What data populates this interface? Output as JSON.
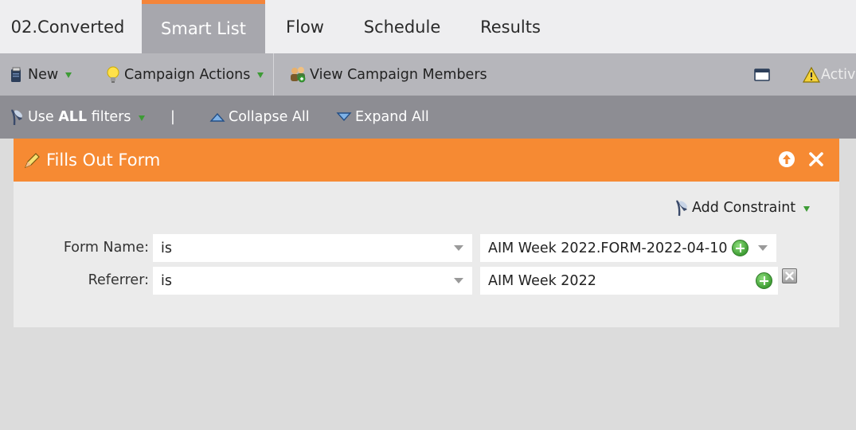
{
  "tabs": [
    {
      "label": "02.Converted"
    },
    {
      "label": "Smart List"
    },
    {
      "label": "Flow"
    },
    {
      "label": "Schedule"
    },
    {
      "label": "Results"
    }
  ],
  "toolbar": {
    "new_label": "New",
    "campaign_actions_label": "Campaign Actions",
    "view_members_label": "View Campaign Members",
    "active_label": "Active"
  },
  "filterbar": {
    "use_prefix": "Use ",
    "use_bold": "ALL",
    "use_suffix": " filters",
    "separator": "|",
    "collapse_label": "Collapse All",
    "expand_label": "Expand All"
  },
  "filter": {
    "title": "Fills Out Form",
    "add_constraint_label": "Add Constraint",
    "rows": [
      {
        "label": "Form Name:",
        "operator": "is",
        "value": "AIM Week 2022.FORM-2022-04-10"
      },
      {
        "label": "Referrer:",
        "operator": "is",
        "value": "AIM Week 2022"
      }
    ]
  },
  "colors": {
    "accent": "#f68a33",
    "tab_active": "#a7a7ad",
    "toolbar": "#b6b6bb",
    "filterbar": "#8d8d93",
    "green_triangle": "#3d9b35"
  }
}
